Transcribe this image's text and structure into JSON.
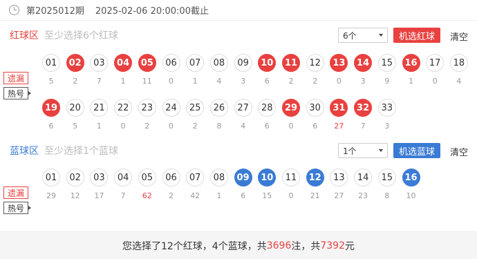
{
  "header": {
    "period": "第2025012期",
    "deadline": "2025-02-06 20:00:00截止"
  },
  "red_section": {
    "title": "红球区",
    "hint": "至少选择6个红球",
    "select_value": "6个",
    "random_button": "机选红球",
    "clear_button": "清空",
    "balls": [
      {
        "num": "01",
        "miss": "5",
        "selected": false
      },
      {
        "num": "02",
        "miss": "2",
        "selected": true
      },
      {
        "num": "03",
        "miss": "7",
        "selected": false
      },
      {
        "num": "04",
        "miss": "1",
        "selected": true
      },
      {
        "num": "05",
        "miss": "11",
        "selected": true
      },
      {
        "num": "06",
        "miss": "0",
        "selected": false
      },
      {
        "num": "07",
        "miss": "1",
        "selected": false
      },
      {
        "num": "08",
        "miss": "4",
        "selected": false
      },
      {
        "num": "09",
        "miss": "3",
        "selected": false
      },
      {
        "num": "10",
        "miss": "6",
        "selected": true
      },
      {
        "num": "11",
        "miss": "2",
        "selected": true
      },
      {
        "num": "12",
        "miss": "2",
        "selected": false
      },
      {
        "num": "13",
        "miss": "0",
        "selected": true
      },
      {
        "num": "14",
        "miss": "3",
        "selected": true
      },
      {
        "num": "15",
        "miss": "9",
        "selected": false
      },
      {
        "num": "16",
        "miss": "1",
        "selected": true
      },
      {
        "num": "17",
        "miss": "0",
        "selected": false
      },
      {
        "num": "18",
        "miss": "4",
        "selected": false
      },
      {
        "num": "19",
        "miss": "6",
        "selected": true
      },
      {
        "num": "20",
        "miss": "5",
        "selected": false
      },
      {
        "num": "21",
        "miss": "1",
        "selected": false
      },
      {
        "num": "22",
        "miss": "0",
        "selected": false
      },
      {
        "num": "23",
        "miss": "2",
        "selected": false
      },
      {
        "num": "24",
        "miss": "0",
        "selected": false
      },
      {
        "num": "25",
        "miss": "2",
        "selected": false
      },
      {
        "num": "26",
        "miss": "8",
        "selected": false
      },
      {
        "num": "27",
        "miss": "4",
        "selected": false
      },
      {
        "num": "28",
        "miss": "6",
        "selected": false
      },
      {
        "num": "29",
        "miss": "0",
        "selected": true
      },
      {
        "num": "30",
        "miss": "6",
        "selected": false
      },
      {
        "num": "31",
        "miss": "27",
        "selected": true,
        "hot": true
      },
      {
        "num": "32",
        "miss": "7",
        "selected": true
      },
      {
        "num": "33",
        "miss": "3",
        "selected": false
      }
    ]
  },
  "blue_section": {
    "title": "蓝球区",
    "hint": "至少选择1个蓝球",
    "select_value": "1个",
    "random_button": "机选蓝球",
    "clear_button": "清空",
    "balls": [
      {
        "num": "01",
        "miss": "29",
        "selected": false
      },
      {
        "num": "02",
        "miss": "12",
        "selected": false
      },
      {
        "num": "03",
        "miss": "17",
        "selected": false
      },
      {
        "num": "04",
        "miss": "7",
        "selected": false
      },
      {
        "num": "05",
        "miss": "62",
        "selected": false,
        "hot": true
      },
      {
        "num": "06",
        "miss": "2",
        "selected": false
      },
      {
        "num": "07",
        "miss": "42",
        "selected": false
      },
      {
        "num": "08",
        "miss": "1",
        "selected": false
      },
      {
        "num": "09",
        "miss": "6",
        "selected": true
      },
      {
        "num": "10",
        "miss": "15",
        "selected": true
      },
      {
        "num": "11",
        "miss": "0",
        "selected": false
      },
      {
        "num": "12",
        "miss": "21",
        "selected": true
      },
      {
        "num": "13",
        "miss": "27",
        "selected": false
      },
      {
        "num": "14",
        "miss": "23",
        "selected": false
      },
      {
        "num": "15",
        "miss": "8",
        "selected": false
      },
      {
        "num": "16",
        "miss": "10",
        "selected": true
      }
    ]
  },
  "tags": {
    "miss_label": "遗漏",
    "hot_label": "热号"
  },
  "summary": {
    "prefix": "您选择了12个红球，4个蓝球，共",
    "bets": "3696",
    "bets_unit": " 注，共 ",
    "amount": "7392",
    "amount_unit": " 元"
  },
  "colors": {
    "red": "#e8413f",
    "blue": "#3a7bd5"
  }
}
